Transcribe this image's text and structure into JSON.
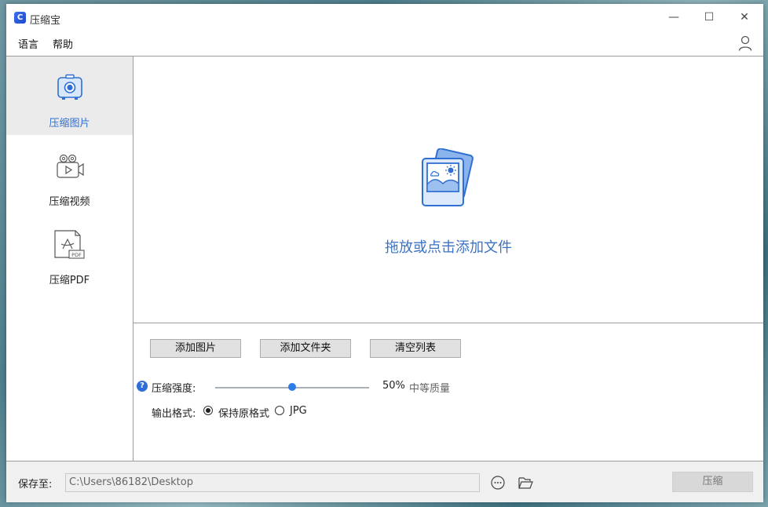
{
  "app": {
    "title": "压缩宝",
    "icon_letter": "C"
  },
  "window_controls": {
    "minimize": "—",
    "maximize": "☐",
    "close": "✕"
  },
  "menu": {
    "items": [
      "语言",
      "帮助"
    ]
  },
  "sidebar": {
    "items": [
      {
        "label": "压缩图片",
        "icon": "image-compress-icon",
        "active": true
      },
      {
        "label": "压缩视频",
        "icon": "video-camera-icon",
        "active": false
      },
      {
        "label": "压缩PDF",
        "icon": "pdf-file-icon",
        "active": false
      }
    ]
  },
  "dropzone": {
    "text": "拖放或点击添加文件",
    "icon": "photo-stack-icon"
  },
  "toolbar": {
    "add_image": "添加图片",
    "add_folder": "添加文件夹",
    "clear_list": "清空列表"
  },
  "compression": {
    "label": "压缩强度:",
    "help": "?",
    "value_text": "50%",
    "value": 0.5,
    "quality": "中等质量"
  },
  "output_format": {
    "label": "输出格式:",
    "options": [
      {
        "label": "保持原格式",
        "checked": true
      },
      {
        "label": "JPG",
        "checked": false
      }
    ]
  },
  "footer": {
    "save_label": "保存至:",
    "save_path": "C:\\Users\\86182\\Desktop",
    "compress_label": "压缩"
  },
  "colors": {
    "accent": "#2f6fd1",
    "drop_text": "#3c72c4",
    "slider": "#2f7ce6"
  }
}
